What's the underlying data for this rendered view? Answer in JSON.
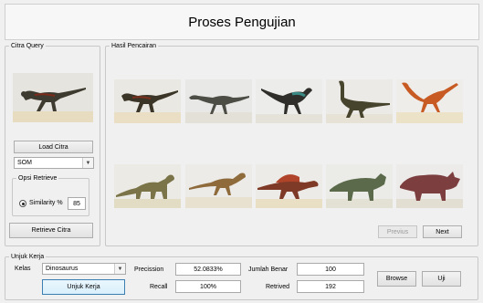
{
  "title": "Proses Pengujian",
  "query_panel": {
    "legend": "Citra Query",
    "load_button": "Load Citra",
    "method_select": "SOM",
    "options_legend": "Opsi Retrieve",
    "radio_label": "Similarity %",
    "similarity_value": "85",
    "retrieve_button": "Retrieve Citra"
  },
  "results_panel": {
    "legend": "Hasil Pencairan",
    "previous_button": "Previus",
    "next_button": "Next",
    "result_images": [
      "raptor",
      "ornithomimid",
      "feathered-raptor",
      "tall-theropod",
      "orange-raptor",
      "sauropod",
      "small-theropod",
      "spinosaurus",
      "ceratopsian",
      "triceratops"
    ]
  },
  "performance_panel": {
    "legend": "Unjuk Kerja",
    "kelas_label": "Kelas",
    "kelas_value": "Dinosaurus",
    "precision_label": "Precission",
    "precision_value": "52.0833%",
    "recall_label": "Recall",
    "recall_value": "100%",
    "jumlah_benar_label": "Jumlah Benar",
    "jumlah_benar_value": "100",
    "retrieved_label": "Retrived",
    "retrieved_value": "192",
    "unjuk_kerja_button": "Unjuk Kerja",
    "browse_button": "Browse",
    "uji_button": "Uji"
  }
}
